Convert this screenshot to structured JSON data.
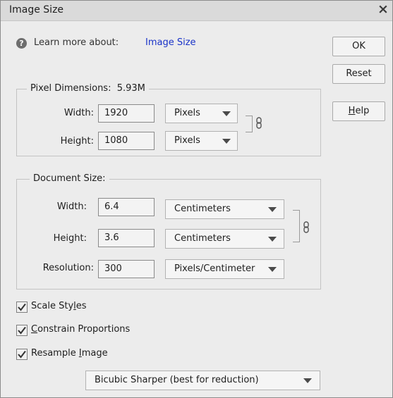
{
  "dialog": {
    "title": "Image Size",
    "close_glyph": "×"
  },
  "help": {
    "icon": "question-circle-icon",
    "text": "Learn more about:",
    "link": "Image Size"
  },
  "buttons": {
    "ok": "OK",
    "reset": "Reset",
    "help_pre": "",
    "help_mnemonic": "H",
    "help_post": "elp"
  },
  "pixel_dimensions": {
    "legend": "Pixel Dimensions:",
    "size": "5.93M",
    "width_label": "Width:",
    "width_value": "1920",
    "width_unit": "Pixels",
    "height_label": "Height:",
    "height_value": "1080",
    "height_unit": "Pixels",
    "link_icon": "chain-link-icon"
  },
  "document_size": {
    "legend": "Document Size:",
    "width_label": "Width:",
    "width_value": "6.4",
    "width_unit": "Centimeters",
    "height_label": "Height:",
    "height_value": "3.6",
    "height_unit": "Centimeters",
    "resolution_label": "Resolution:",
    "resolution_value": "300",
    "resolution_unit": "Pixels/Centimeter",
    "link_icon": "chain-link-icon"
  },
  "options": {
    "scale_styles": {
      "pre": "Scale Sty",
      "mnemonic": "l",
      "post": "es",
      "checked": true
    },
    "constrain": {
      "pre": "",
      "mnemonic": "C",
      "post": "onstrain Proportions",
      "checked": true
    },
    "resample": {
      "pre": "Resample ",
      "mnemonic": "I",
      "post": "mage",
      "checked": true
    }
  },
  "resample_method": "Bicubic Sharper (best for reduction)",
  "colors": {
    "dialog_bg": "#ececec",
    "title_bg": "#dadada",
    "link": "#1a33c8"
  }
}
